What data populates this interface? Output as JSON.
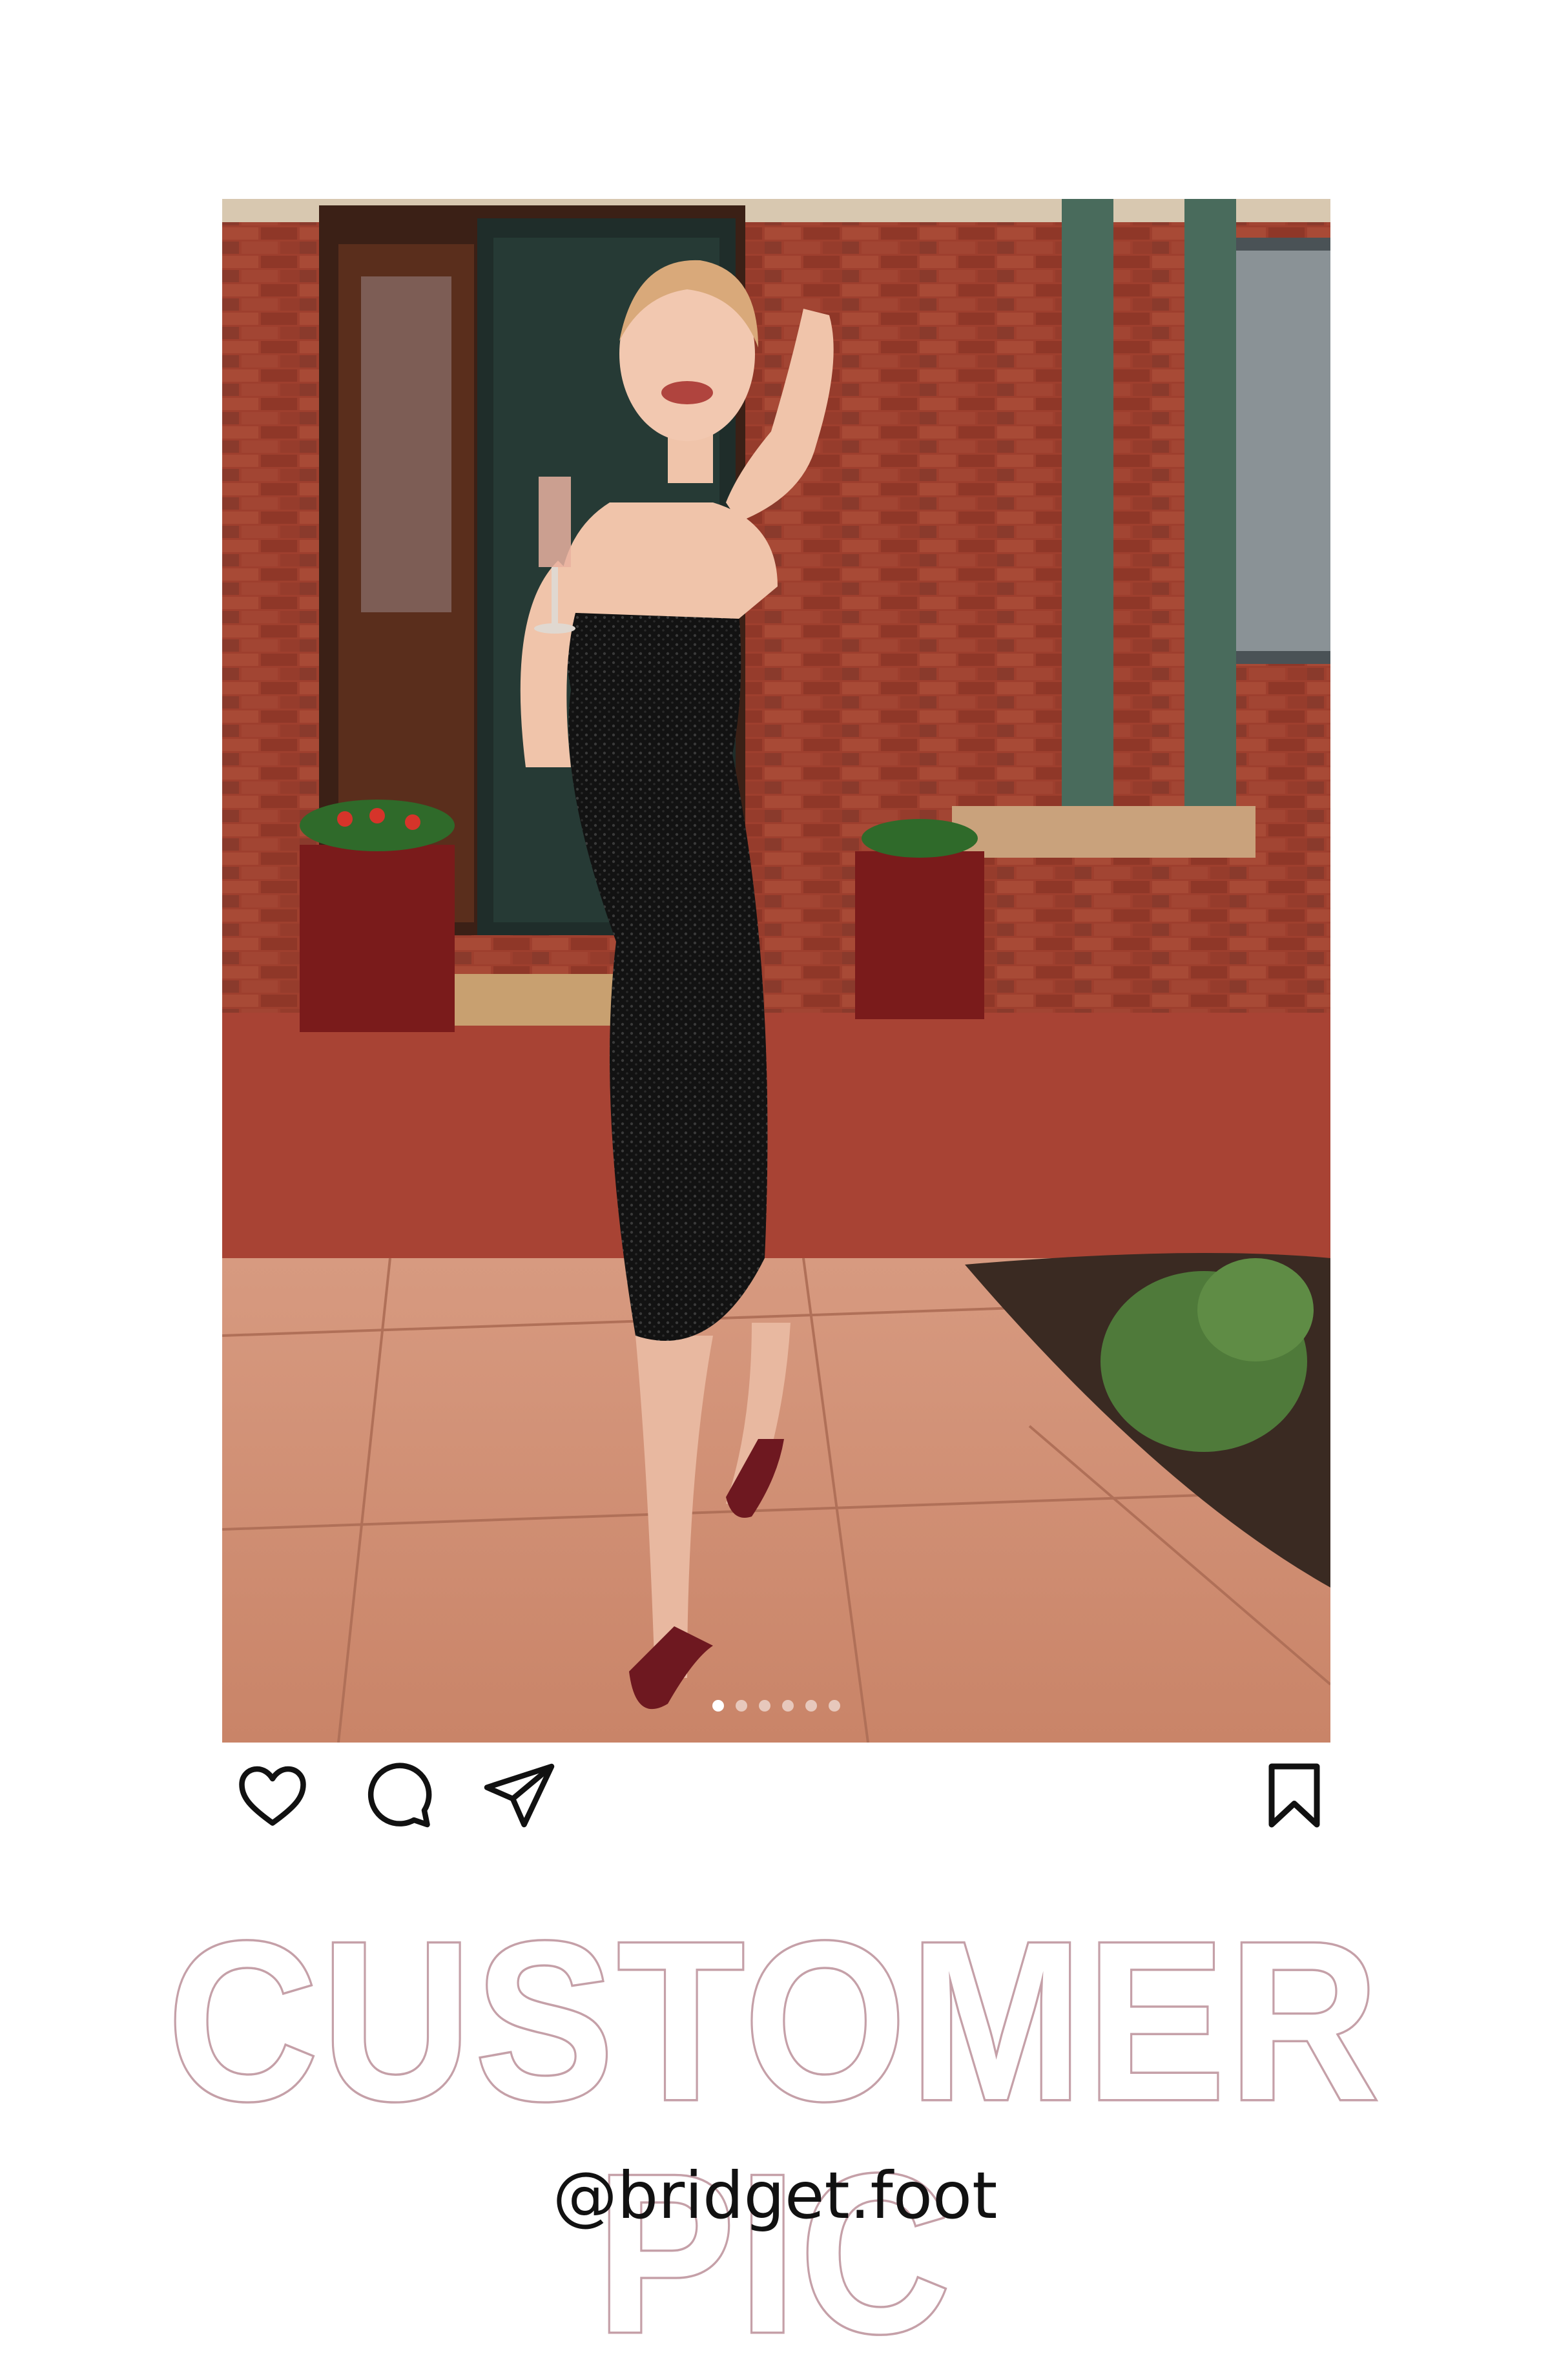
{
  "post": {
    "photo_description": "",
    "carousel": {
      "count": 6,
      "active_index": 0
    },
    "actions": {
      "like_icon": "heart-icon",
      "comment_icon": "comment-icon",
      "share_icon": "paper-plane-icon",
      "save_icon": "bookmark-icon"
    }
  },
  "caption": {
    "title": "CUSTOMER PIC",
    "handle": "@bridget.foot"
  },
  "colors": {
    "title_outline": "#c5a0a8",
    "background": "#ffffff",
    "icon": "#111111"
  }
}
